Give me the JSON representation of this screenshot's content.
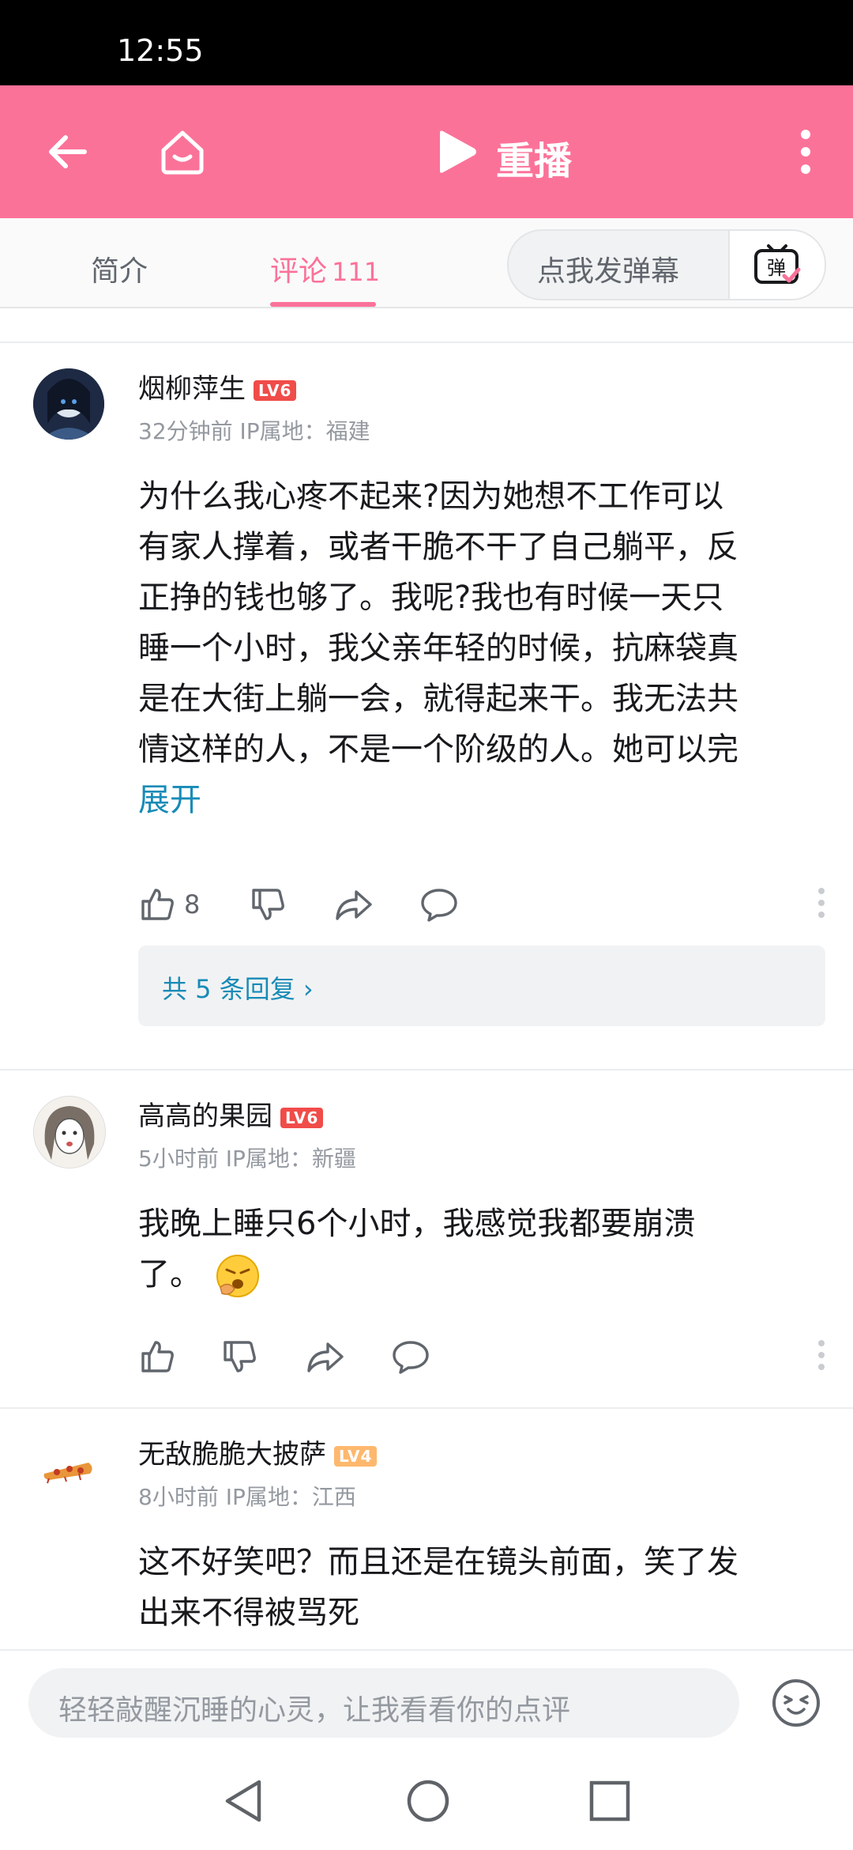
{
  "status_bar": {
    "time": "12:55"
  },
  "top_bar": {
    "replay_label": "重播"
  },
  "tabs": {
    "intro": "简介",
    "comments": "评论",
    "comments_count": "111",
    "danmaku_placeholder": "点我发弹幕",
    "danmaku_button": "弹"
  },
  "comments": [
    {
      "username": "烟柳萍生",
      "level": "LV6",
      "meta": "32分钟前 IP属地：福建",
      "lines": [
        "为什么我心疼不起来?因为她想不工作可以",
        "有家人撑着，或者干脆不干了自己躺平，反",
        "正挣的钱也够了。我呢?我也有时候一天只",
        "睡一个小时，我父亲年轻的时候，抗麻袋真",
        "是在大街上躺一会，就得起来干。我无法共",
        "情这样的人，不是一个阶级的人。她可以完"
      ],
      "expand": "展开",
      "likes": "8",
      "replies_label": "共 5 条回复 ›"
    },
    {
      "username": "高高的果园",
      "level": "LV6",
      "meta": "5小时前 IP属地：新疆",
      "lines": [
        "我晚上睡只6个小时，我感觉我都要崩溃",
        "了。"
      ]
    },
    {
      "username": "无敌脆脆大披萨",
      "level": "LV4",
      "meta": "8小时前 IP属地：江西",
      "lines": [
        "这不好笑吧？而且还是在镜头前面，笑了发",
        "出来不得被骂死"
      ]
    }
  ],
  "bottom": {
    "comment_placeholder": "轻轻敲醒沉睡的心灵，让我看看你的点评"
  },
  "colors": {
    "brand_pink": "#fb7299",
    "link_blue": "#178bb7",
    "lv6_red": "#f04c49",
    "lv4_orange": "#feb86e"
  }
}
